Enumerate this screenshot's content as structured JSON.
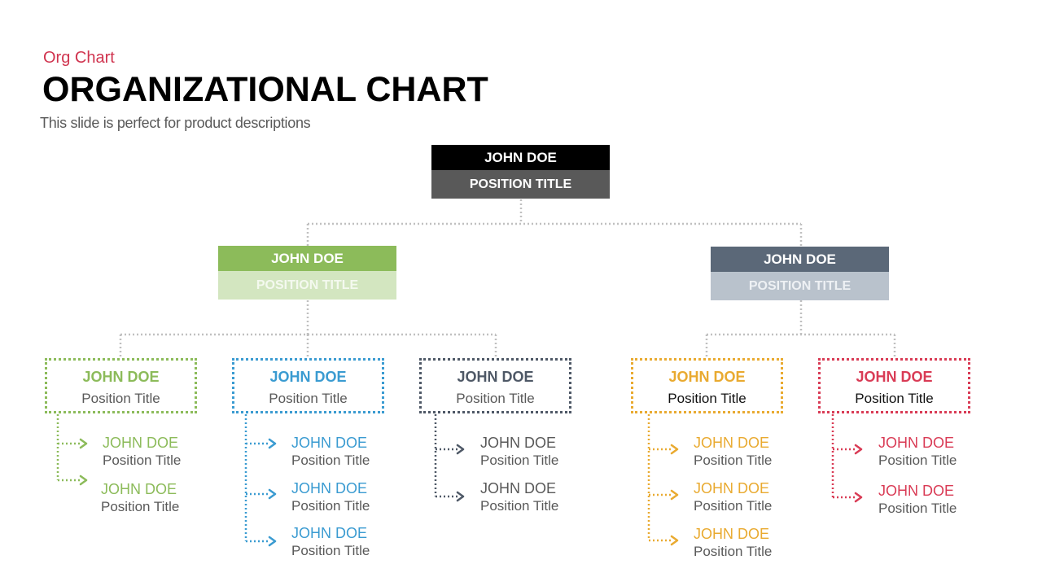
{
  "header": {
    "category": "Org Chart",
    "title": "ORGANIZATIONAL CHART",
    "description": "This slide is perfect for product descriptions"
  },
  "colors": {
    "accent_red": "#d0344f",
    "green": "#8cbb5a",
    "green_light": "#d3e6c0",
    "slate": "#5b6878",
    "slate_light": "#b9c2cc",
    "blue": "#3a9bd1",
    "dark_gray": "#4e5866",
    "orange": "#e9aa30",
    "red": "#d93b55",
    "top_name_bg": "#000000",
    "top_pos_bg": "#595959",
    "connector": "#c0c0c0"
  },
  "org": {
    "top": {
      "name": "JOHN DOE",
      "position": "POSITION TITLE"
    },
    "level2": [
      {
        "name": "JOHN DOE",
        "position": "POSITION TITLE",
        "theme": "green"
      },
      {
        "name": "JOHN DOE",
        "position": "POSITION TITLE",
        "theme": "slate"
      }
    ],
    "level3": [
      {
        "name": "JOHN DOE",
        "position": "Position Title",
        "theme": "green",
        "reports": [
          {
            "name": "JOHN DOE",
            "position": "Position Title"
          },
          {
            "name": "JOHN DOE",
            "position": "Position Title"
          }
        ]
      },
      {
        "name": "JOHN DOE",
        "position": "Position Title",
        "theme": "blue",
        "reports": [
          {
            "name": "JOHN DOE",
            "position": "Position Title"
          },
          {
            "name": "JOHN DOE",
            "position": "Position Title"
          },
          {
            "name": "JOHN DOE",
            "position": "Position Title"
          }
        ]
      },
      {
        "name": "JOHN DOE",
        "position": "Position Title",
        "theme": "dark_gray",
        "reports": [
          {
            "name": "JOHN DOE",
            "position": "Position Title"
          },
          {
            "name": "JOHN DOE",
            "position": "Position Title"
          }
        ]
      },
      {
        "name": "JOHN DOE",
        "position": "Position Title",
        "theme": "orange",
        "reports": [
          {
            "name": "JOHN DOE",
            "position": "Position Title"
          },
          {
            "name": "JOHN DOE",
            "position": "Position Title"
          },
          {
            "name": "JOHN DOE",
            "position": "Position Title"
          }
        ]
      },
      {
        "name": "JOHN DOE",
        "position": "Position Title",
        "theme": "red",
        "reports": [
          {
            "name": "JOHN DOE",
            "position": "Position Title"
          },
          {
            "name": "JOHN DOE",
            "position": "Position Title"
          }
        ]
      }
    ]
  }
}
